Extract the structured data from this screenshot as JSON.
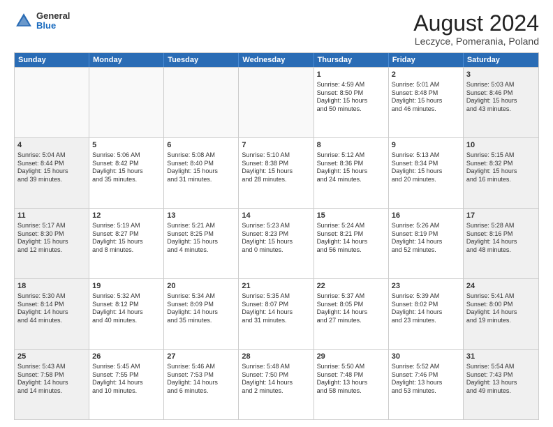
{
  "logo": {
    "line1": "General",
    "line2": "Blue"
  },
  "title": "August 2024",
  "subtitle": "Leczyce, Pomerania, Poland",
  "weekdays": [
    "Sunday",
    "Monday",
    "Tuesday",
    "Wednesday",
    "Thursday",
    "Friday",
    "Saturday"
  ],
  "rows": [
    [
      {
        "day": "",
        "text": "",
        "empty": true
      },
      {
        "day": "",
        "text": "",
        "empty": true
      },
      {
        "day": "",
        "text": "",
        "empty": true
      },
      {
        "day": "",
        "text": "",
        "empty": true
      },
      {
        "day": "1",
        "text": "Sunrise: 4:59 AM\nSunset: 8:50 PM\nDaylight: 15 hours\nand 50 minutes.",
        "empty": false
      },
      {
        "day": "2",
        "text": "Sunrise: 5:01 AM\nSunset: 8:48 PM\nDaylight: 15 hours\nand 46 minutes.",
        "empty": false
      },
      {
        "day": "3",
        "text": "Sunrise: 5:03 AM\nSunset: 8:46 PM\nDaylight: 15 hours\nand 43 minutes.",
        "empty": false,
        "shaded": true
      }
    ],
    [
      {
        "day": "4",
        "text": "Sunrise: 5:04 AM\nSunset: 8:44 PM\nDaylight: 15 hours\nand 39 minutes.",
        "empty": false,
        "shaded": true
      },
      {
        "day": "5",
        "text": "Sunrise: 5:06 AM\nSunset: 8:42 PM\nDaylight: 15 hours\nand 35 minutes.",
        "empty": false
      },
      {
        "day": "6",
        "text": "Sunrise: 5:08 AM\nSunset: 8:40 PM\nDaylight: 15 hours\nand 31 minutes.",
        "empty": false
      },
      {
        "day": "7",
        "text": "Sunrise: 5:10 AM\nSunset: 8:38 PM\nDaylight: 15 hours\nand 28 minutes.",
        "empty": false
      },
      {
        "day": "8",
        "text": "Sunrise: 5:12 AM\nSunset: 8:36 PM\nDaylight: 15 hours\nand 24 minutes.",
        "empty": false
      },
      {
        "day": "9",
        "text": "Sunrise: 5:13 AM\nSunset: 8:34 PM\nDaylight: 15 hours\nand 20 minutes.",
        "empty": false
      },
      {
        "day": "10",
        "text": "Sunrise: 5:15 AM\nSunset: 8:32 PM\nDaylight: 15 hours\nand 16 minutes.",
        "empty": false,
        "shaded": true
      }
    ],
    [
      {
        "day": "11",
        "text": "Sunrise: 5:17 AM\nSunset: 8:30 PM\nDaylight: 15 hours\nand 12 minutes.",
        "empty": false,
        "shaded": true
      },
      {
        "day": "12",
        "text": "Sunrise: 5:19 AM\nSunset: 8:27 PM\nDaylight: 15 hours\nand 8 minutes.",
        "empty": false
      },
      {
        "day": "13",
        "text": "Sunrise: 5:21 AM\nSunset: 8:25 PM\nDaylight: 15 hours\nand 4 minutes.",
        "empty": false
      },
      {
        "day": "14",
        "text": "Sunrise: 5:23 AM\nSunset: 8:23 PM\nDaylight: 15 hours\nand 0 minutes.",
        "empty": false
      },
      {
        "day": "15",
        "text": "Sunrise: 5:24 AM\nSunset: 8:21 PM\nDaylight: 14 hours\nand 56 minutes.",
        "empty": false
      },
      {
        "day": "16",
        "text": "Sunrise: 5:26 AM\nSunset: 8:19 PM\nDaylight: 14 hours\nand 52 minutes.",
        "empty": false
      },
      {
        "day": "17",
        "text": "Sunrise: 5:28 AM\nSunset: 8:16 PM\nDaylight: 14 hours\nand 48 minutes.",
        "empty": false,
        "shaded": true
      }
    ],
    [
      {
        "day": "18",
        "text": "Sunrise: 5:30 AM\nSunset: 8:14 PM\nDaylight: 14 hours\nand 44 minutes.",
        "empty": false,
        "shaded": true
      },
      {
        "day": "19",
        "text": "Sunrise: 5:32 AM\nSunset: 8:12 PM\nDaylight: 14 hours\nand 40 minutes.",
        "empty": false
      },
      {
        "day": "20",
        "text": "Sunrise: 5:34 AM\nSunset: 8:09 PM\nDaylight: 14 hours\nand 35 minutes.",
        "empty": false
      },
      {
        "day": "21",
        "text": "Sunrise: 5:35 AM\nSunset: 8:07 PM\nDaylight: 14 hours\nand 31 minutes.",
        "empty": false
      },
      {
        "day": "22",
        "text": "Sunrise: 5:37 AM\nSunset: 8:05 PM\nDaylight: 14 hours\nand 27 minutes.",
        "empty": false
      },
      {
        "day": "23",
        "text": "Sunrise: 5:39 AM\nSunset: 8:02 PM\nDaylight: 14 hours\nand 23 minutes.",
        "empty": false
      },
      {
        "day": "24",
        "text": "Sunrise: 5:41 AM\nSunset: 8:00 PM\nDaylight: 14 hours\nand 19 minutes.",
        "empty": false,
        "shaded": true
      }
    ],
    [
      {
        "day": "25",
        "text": "Sunrise: 5:43 AM\nSunset: 7:58 PM\nDaylight: 14 hours\nand 14 minutes.",
        "empty": false,
        "shaded": true
      },
      {
        "day": "26",
        "text": "Sunrise: 5:45 AM\nSunset: 7:55 PM\nDaylight: 14 hours\nand 10 minutes.",
        "empty": false
      },
      {
        "day": "27",
        "text": "Sunrise: 5:46 AM\nSunset: 7:53 PM\nDaylight: 14 hours\nand 6 minutes.",
        "empty": false
      },
      {
        "day": "28",
        "text": "Sunrise: 5:48 AM\nSunset: 7:50 PM\nDaylight: 14 hours\nand 2 minutes.",
        "empty": false
      },
      {
        "day": "29",
        "text": "Sunrise: 5:50 AM\nSunset: 7:48 PM\nDaylight: 13 hours\nand 58 minutes.",
        "empty": false
      },
      {
        "day": "30",
        "text": "Sunrise: 5:52 AM\nSunset: 7:46 PM\nDaylight: 13 hours\nand 53 minutes.",
        "empty": false
      },
      {
        "day": "31",
        "text": "Sunrise: 5:54 AM\nSunset: 7:43 PM\nDaylight: 13 hours\nand 49 minutes.",
        "empty": false,
        "shaded": true
      }
    ]
  ]
}
